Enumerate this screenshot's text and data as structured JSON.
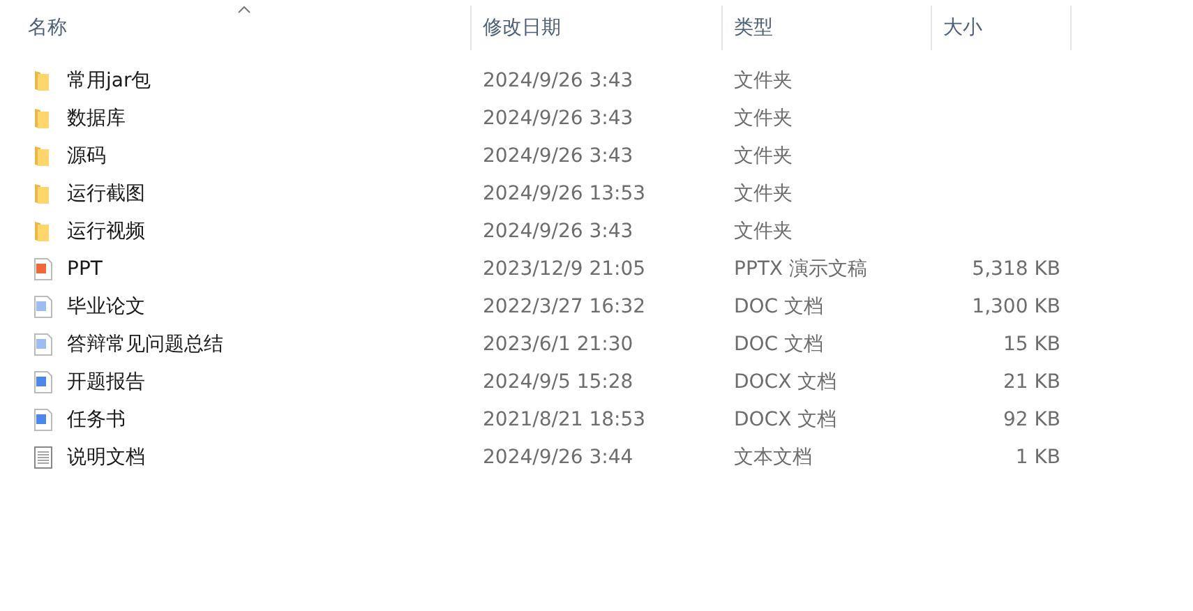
{
  "columns": [
    {
      "label": "名称",
      "sorted": true
    },
    {
      "label": "修改日期"
    },
    {
      "label": "类型"
    },
    {
      "label": "大小"
    }
  ],
  "rows": [
    {
      "kind": "folder",
      "name": "常用jar包",
      "modified": "2024/9/26 3:43",
      "type": "文件夹"
    },
    {
      "kind": "folder",
      "name": "数据库",
      "modified": "2024/9/26 3:43",
      "type": "文件夹"
    },
    {
      "kind": "folder",
      "name": "源码",
      "modified": "2024/9/26 3:43",
      "type": "文件夹"
    },
    {
      "kind": "folder",
      "name": "运行截图",
      "modified": "2024/9/26 13:53",
      "type": "文件夹"
    },
    {
      "kind": "folder",
      "name": "运行视频",
      "modified": "2024/9/26 3:43",
      "type": "文件夹"
    },
    {
      "kind": "ppt",
      "name": "PPT",
      "modified": "2023/12/9 21:05",
      "type": "PPTX 演示文稿",
      "size": "5,318 KB"
    },
    {
      "kind": "doc",
      "name": "毕业论文",
      "modified": "2022/3/27 16:32",
      "type": "DOC 文档",
      "size": "1,300 KB"
    },
    {
      "kind": "doc",
      "name": "答辩常见问题总结",
      "modified": "2023/6/1 21:30",
      "type": "DOC 文档",
      "size": "15 KB"
    },
    {
      "kind": "docx",
      "name": "开题报告",
      "modified": "2024/9/5 15:28",
      "type": "DOCX 文档",
      "size": "21 KB"
    },
    {
      "kind": "docx",
      "name": "任务书",
      "modified": "2021/8/21 18:53",
      "type": "DOCX 文档",
      "size": "92 KB"
    },
    {
      "kind": "txt",
      "name": "说明文档",
      "modified": "2024/9/26 3:44",
      "type": "文本文档",
      "size": "1 KB"
    }
  ]
}
